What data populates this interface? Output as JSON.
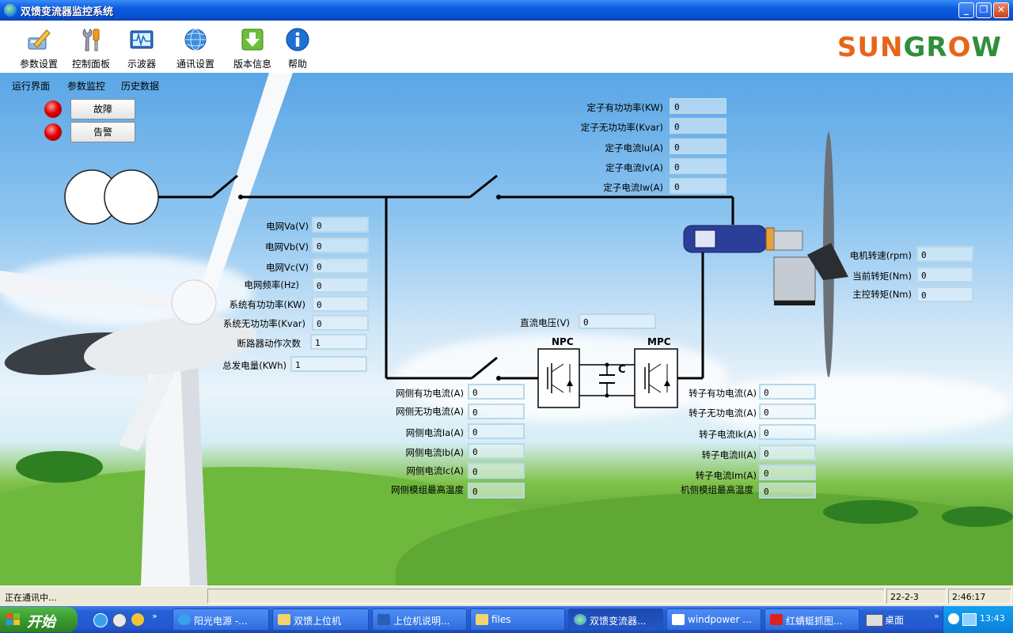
{
  "window": {
    "title": "双馈变流器监控系统"
  },
  "toolbar": {
    "items": [
      {
        "label": "参数设置",
        "icon": "settings-pencil-icon"
      },
      {
        "label": "控制面板",
        "icon": "wrench-screwdriver-icon"
      },
      {
        "label": "示波器",
        "icon": "oscilloscope-icon"
      },
      {
        "label": "通讯设置",
        "icon": "globe-network-icon"
      },
      {
        "label": "版本信息",
        "icon": "download-arrow-icon"
      },
      {
        "label": "帮助",
        "icon": "info-icon"
      }
    ],
    "logo": {
      "part1": "SUNGR",
      "part2": "W",
      "o": "O"
    }
  },
  "tabs": [
    "运行界面",
    "参数监控",
    "历史数据"
  ],
  "alarms": {
    "fault": "故障",
    "warning": "告警",
    "led_color": "#e00000"
  },
  "stator": [
    {
      "label": "定子有功功率(KW)",
      "value": "0"
    },
    {
      "label": "定子无功功率(Kvar)",
      "value": "0"
    },
    {
      "label": "定子电流Iu(A)",
      "value": "0"
    },
    {
      "label": "定子电流Iv(A)",
      "value": "0"
    },
    {
      "label": "定子电流Iw(A)",
      "value": "0"
    }
  ],
  "grid": [
    {
      "label": "电网Va(V)",
      "value": "0"
    },
    {
      "label": "电网Vb(V)",
      "value": "0"
    },
    {
      "label": "电网Vc(V)",
      "value": "0"
    },
    {
      "label": "电网频率(Hz)",
      "value": "0"
    },
    {
      "label": "系统有功功率(KW)",
      "value": "0"
    },
    {
      "label": "系统无功功率(Kvar)",
      "value": "0"
    },
    {
      "label": "断路器动作次数",
      "value": "1"
    },
    {
      "label": "总发电量(KWh)",
      "value": "1"
    }
  ],
  "motor": [
    {
      "label": "电机转速(rpm)",
      "value": "0"
    },
    {
      "label": "当前转矩(Nm)",
      "value": "0"
    },
    {
      "label": "主控转矩(Nm)",
      "value": "0"
    }
  ],
  "dc": {
    "label": "直流电压(V)",
    "value": "0"
  },
  "gridside": [
    {
      "label": "网侧有功电流(A)",
      "value": "0"
    },
    {
      "label": "网侧无功电流(A)",
      "value": "0"
    },
    {
      "label": "网侧电流Ia(A)",
      "value": "0"
    },
    {
      "label": "网侧电流Ib(A)",
      "value": "0"
    },
    {
      "label": "网侧电流Ic(A)",
      "value": "0"
    },
    {
      "label": "网侧模组最高温度",
      "value": "0"
    }
  ],
  "rotor": [
    {
      "label": "转子有功电流(A)",
      "value": "0"
    },
    {
      "label": "转子无功电流(A)",
      "value": "0"
    },
    {
      "label": "转子电流Ik(A)",
      "value": "0"
    },
    {
      "label": "转子电流Il(A)",
      "value": "0"
    },
    {
      "label": "转子电流Im(A)",
      "value": "0"
    },
    {
      "label": "机侧模组最高温度",
      "value": "0"
    }
  ],
  "diagram": {
    "npc": "NPC",
    "mpc": "MPC",
    "cap": "C"
  },
  "status": {
    "message": "正在通讯中...",
    "date": "22-2-3",
    "time": "2:46:17"
  },
  "taskbar": {
    "start": "开始",
    "tasks": [
      "阳光电源 -...",
      "双馈上位机",
      "上位机说明...",
      "files",
      "双馈变流器...",
      "windpower ...",
      "红蜻蜓抓图..."
    ],
    "desktop": "桌面",
    "clock": "13:43"
  }
}
